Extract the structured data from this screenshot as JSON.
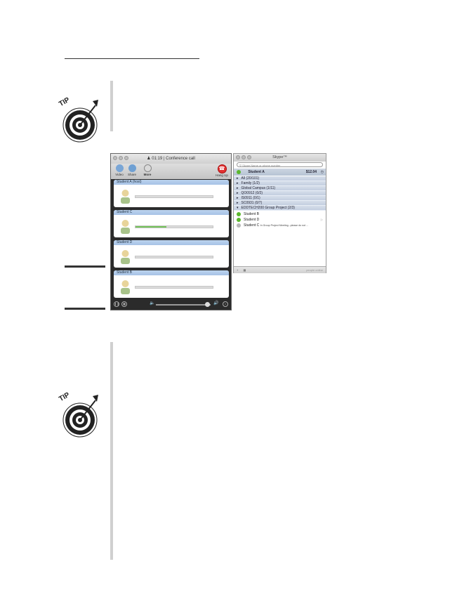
{
  "conference": {
    "timer": "01:19",
    "title_sep": "|",
    "title": "Conference call",
    "toolbar": {
      "video_label": "Video",
      "share_label": "Share",
      "more_label": "More",
      "hangup_label": "Hang Up"
    },
    "participants": [
      {
        "name": "Student A",
        "suffix": "(host)",
        "level": 0.0
      },
      {
        "name": "Student C",
        "suffix": "",
        "level": 0.4
      },
      {
        "name": "Student D",
        "suffix": "",
        "level": 0.0
      },
      {
        "name": "Student B",
        "suffix": "",
        "level": 0.0
      }
    ]
  },
  "skype": {
    "title": "Skype™",
    "search_placeholder": "Skype Name or phone number",
    "user": {
      "name": "Student A",
      "credit": "$12.04"
    },
    "groups": [
      "All (20/101)",
      "Family (1/2)",
      "Global Campus (1/11)",
      "QO0912 (0/2)",
      "IS0911 (0/1)",
      "SC0931 (0/7)",
      "EDDTECH200 Group Project (2/3)"
    ],
    "contacts": [
      {
        "name": "Student B",
        "status": "",
        "color": "#5bb82d"
      },
      {
        "name": "Student D",
        "status": "",
        "color": "#5bb82d"
      },
      {
        "name": "Student C",
        "status": "In Group Project Meeting...please do not ...",
        "color": "#b7b7b7"
      }
    ],
    "footer_text": "people online"
  },
  "tip_word_1": "TIP",
  "tip_word_2": "TIP"
}
